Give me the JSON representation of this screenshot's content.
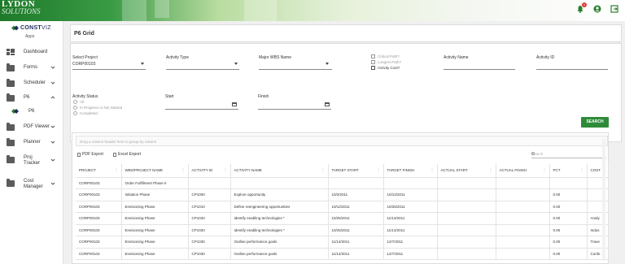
{
  "topbar": {
    "logo_line1": "LYDON",
    "logo_line2": "SOLUTIONS",
    "notification_count": "1"
  },
  "sidebar": {
    "brand": "CONSTVIZ",
    "brand_part1": "CONST",
    "brand_part2": "VIZ",
    "apps_label": "Apps",
    "items": [
      {
        "label": "Dashboard",
        "icon": "dashboard-icon"
      },
      {
        "label": "Forms",
        "icon": "folder-icon"
      },
      {
        "label": "Scheduler",
        "icon": "folder-icon"
      },
      {
        "label": "P6",
        "icon": "folder-icon"
      },
      {
        "label": "P6",
        "icon": "p6-icon"
      },
      {
        "label": "PDF Viewer",
        "icon": "folder-icon"
      },
      {
        "label": "Planner",
        "icon": "folder-icon"
      },
      {
        "label": "Proj Tracker",
        "icon": "folder-icon"
      },
      {
        "label": "Cost Manager",
        "icon": "folder-icon"
      }
    ]
  },
  "page": {
    "title": "P6 Grid"
  },
  "filters": {
    "select_project_label": "Select Project",
    "select_project_value": "CORP00103",
    "activity_type_label": "Activity Type",
    "major_wbs_label": "Major WBS Name",
    "critical_path_label": "Critical Path?",
    "longest_path_label": "Longest Path?",
    "activity_cost_label": "Activity Cost?",
    "activity_name_label": "Activity Name",
    "activity_id_label": "Activity ID",
    "activity_status_label": "Activity Status",
    "status_all": "All",
    "status_in_progress": "In Progress or Not Started",
    "status_completed": "Completed",
    "start_label": "Start",
    "finish_label": "Finish",
    "search_button": "SEARCH"
  },
  "grid": {
    "group_hint": "Drag a column header here to group by column",
    "pdf_export": "PDF Export",
    "excel_export": "Excel Export",
    "search_placeholder": "Search",
    "columns": [
      "PROJECT",
      "WBS/PROJECT NAME",
      "ACTIVITY ID",
      "ACTIVITY NAME",
      "TARGET START",
      "TARGET FINISH",
      "ACTUAL START",
      "ACTUAL FINISH",
      "PCT",
      "COST"
    ],
    "rows": [
      [
        "CORP00103",
        "Order Fulfillment Phase II",
        "",
        "",
        "",
        "",
        "",
        "",
        "",
        ""
      ],
      [
        "CORP00103",
        "Initiation Phase",
        "CP1000",
        "Explore opportunity",
        "10/2/2011",
        "10/12/2011",
        "",
        "",
        "0.00",
        ""
      ],
      [
        "CORP00103",
        "Envisioning Phase",
        "CP1010",
        "Define reengineering opportunities",
        "10/12/2011",
        "10/25/2011",
        "",
        "",
        "0.00",
        ""
      ],
      [
        "CORP00103",
        "Envisioning Phase",
        "CP1020",
        "Identify enabling technologies *",
        "10/25/2011",
        "11/14/2011",
        "",
        "",
        "0.00",
        "Analy"
      ],
      [
        "CORP00103",
        "Envisioning Phase",
        "CP1020",
        "Identify enabling technologies *",
        "10/25/2011",
        "11/14/2011",
        "",
        "",
        "0.00",
        "Indus"
      ],
      [
        "CORP00103",
        "Envisioning Phase",
        "CP1030",
        "Outline performance goals",
        "11/14/2011",
        "12/7/2011",
        "",
        "",
        "0.00",
        "Trave"
      ],
      [
        "CORP00103",
        "Envisioning Phase",
        "CP1030",
        "Outline performance goals",
        "11/14/2011",
        "12/7/2011",
        "",
        "",
        "0.00",
        "Confe"
      ]
    ]
  }
}
